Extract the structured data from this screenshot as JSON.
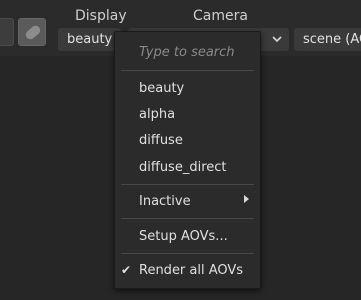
{
  "toolbar": {
    "display_label": "Display",
    "camera_label": "Camera",
    "display_value": "beauty",
    "camera_value": "",
    "scene_value": "scene (AOVs)"
  },
  "dropdown": {
    "search_placeholder": "Type to search",
    "aovs": [
      "beauty",
      "alpha",
      "diffuse",
      "diffuse_direct"
    ],
    "inactive_label": "Inactive",
    "setup_label": "Setup AOVs...",
    "render_all_label": "Render all AOVs",
    "render_all_checked": true
  },
  "icons": [
    "checkmark-icon",
    "submenu-arrow-icon",
    "chevron-down-icon",
    "pill-icon"
  ]
}
